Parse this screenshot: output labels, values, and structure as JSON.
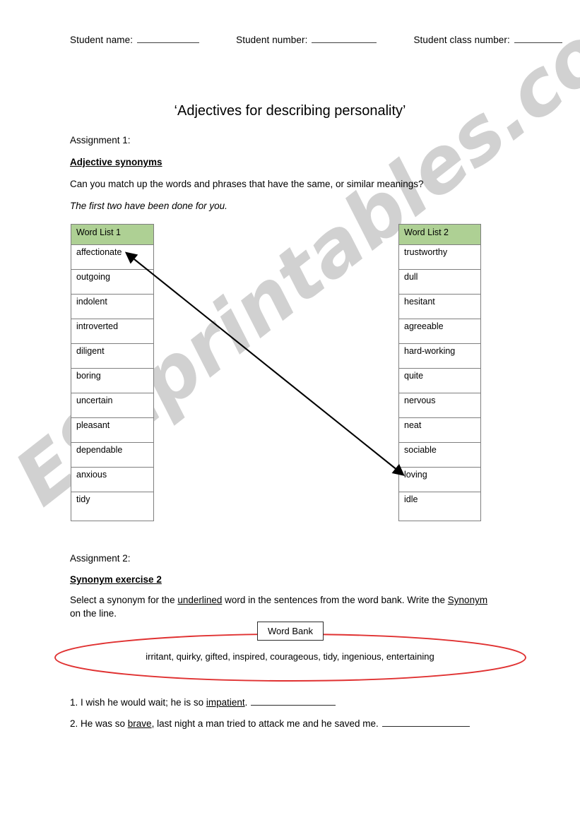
{
  "header": {
    "student_name_label": "Student name:",
    "student_number_label": "Student number:",
    "student_class_number_label": "Student class number:"
  },
  "title": "‘Adjectives for describing personality’",
  "assignment1": {
    "label": "Assignment 1:",
    "heading": "Adjective synonyms",
    "instruction": "Can you match up the words and phrases that have the same, or similar meanings?",
    "note": "The first two have been done for you.",
    "word_list_1": {
      "header": "Word List 1",
      "items": [
        "affectionate",
        "outgoing",
        "indolent",
        "introverted",
        "diligent",
        "boring",
        "uncertain",
        "pleasant",
        "dependable",
        "anxious",
        "tidy"
      ]
    },
    "word_list_2": {
      "header": "Word List 2",
      "items": [
        "trustworthy",
        "dull",
        "hesitant",
        "agreeable",
        "hard-working",
        "quite",
        "nervous",
        "neat",
        "sociable",
        "loving",
        "idle"
      ]
    },
    "matched_pair": {
      "from": "affectionate",
      "to": "loving"
    },
    "header_fill_color": "#aed094"
  },
  "assignment2": {
    "label": "Assignment 2:",
    "heading": "Synonym exercise 2",
    "instruction_part1": "Select a synonym for the ",
    "instruction_underlined1": "underlined",
    "instruction_part2": " word in the sentences from the word bank. Write the ",
    "instruction_underlined2": "Synonym",
    "instruction_part3": " on the line.",
    "word_bank": {
      "label": "Word Bank",
      "words": "irritant, quirky, gifted, inspired, courageous, tidy, ingenious, entertaining",
      "oval_color": "#e03131"
    },
    "sentences": [
      {
        "number": "1.",
        "before": " I wish he would wait; he is so ",
        "underlined": "impatient",
        "after": "."
      },
      {
        "number": "2.",
        "before": " He was so ",
        "underlined": "brave",
        "after": ", last night a man tried to attack me and he saved me."
      }
    ]
  },
  "watermark": {
    "text": "ESLprintables.com",
    "color": "#c9c9c9"
  }
}
